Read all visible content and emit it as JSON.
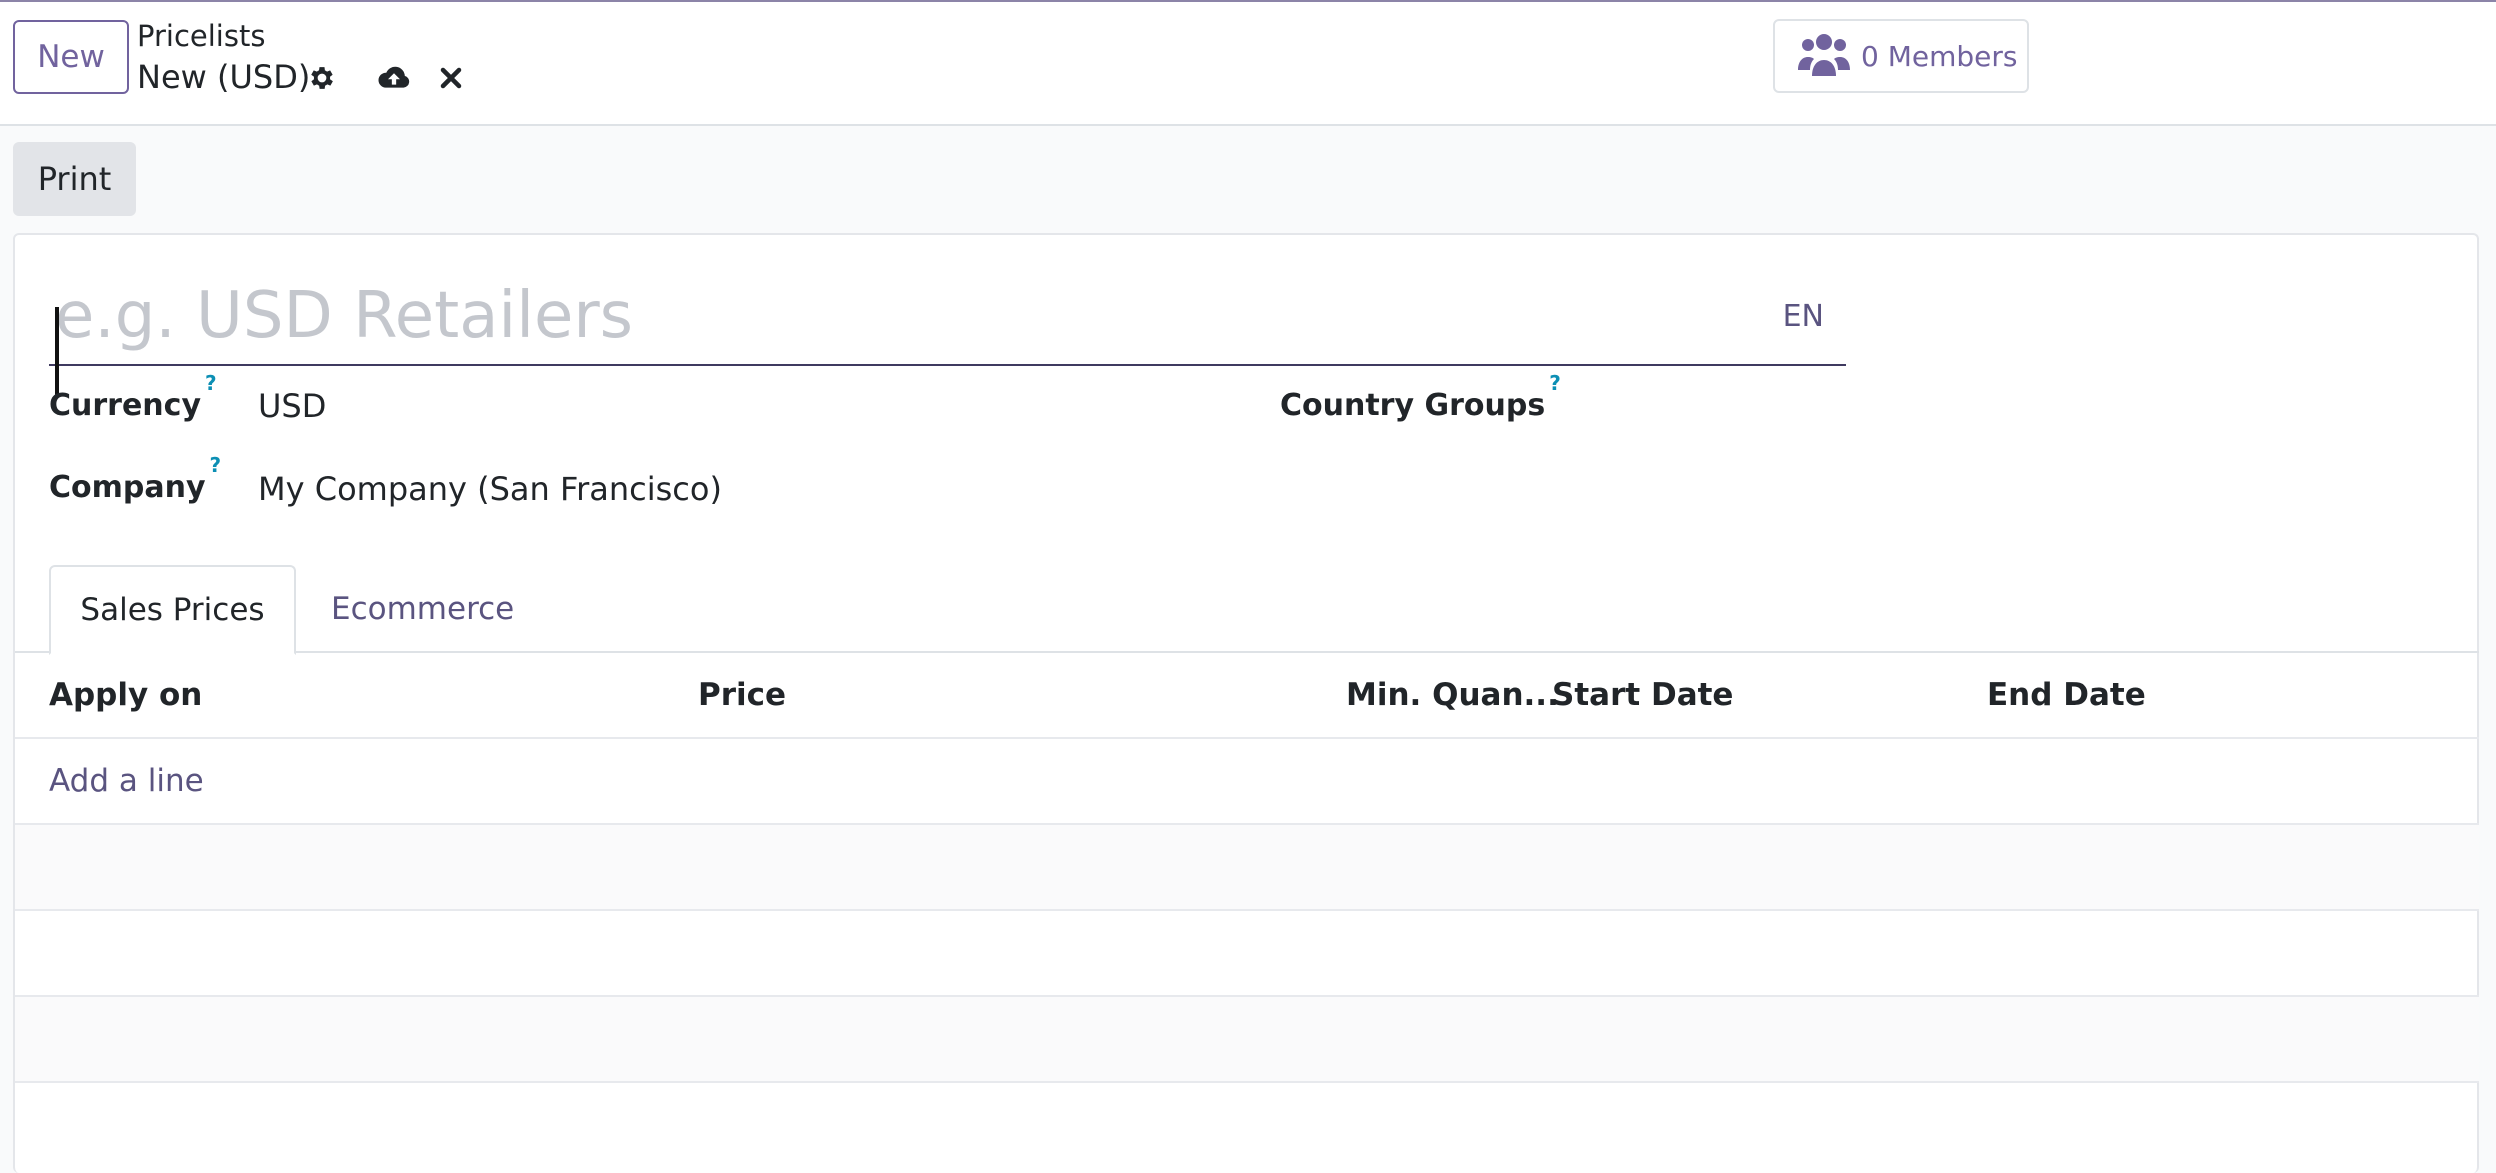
{
  "top_bar": {
    "new_button": "New",
    "breadcrumb": "Pricelists",
    "record_title": "New (USD)",
    "members_button": "0 Members"
  },
  "control_panel": {
    "print_button": "Print"
  },
  "form": {
    "name_placeholder": "e.g. USD Retailers",
    "name_value": "",
    "language_badge": "EN",
    "currency_label": "Currency",
    "currency_value": "USD",
    "company_label": "Company",
    "company_value": "My Company (San Francisco)",
    "country_groups_label": "Country Groups",
    "help_marker": "?"
  },
  "tabs": [
    {
      "label": "Sales Prices",
      "active": true
    },
    {
      "label": "Ecommerce",
      "active": false
    }
  ],
  "table": {
    "columns": [
      "Apply on",
      "Price",
      "Min. Quan...",
      "Start Date",
      "End Date"
    ],
    "add_line": "Add a line"
  },
  "colors": {
    "accent": "#71639e",
    "help": "#0c8fb4",
    "border": "#dee2e6"
  },
  "icons": [
    "gear-icon",
    "cloud-upload-icon",
    "close-icon",
    "users-icon"
  ]
}
